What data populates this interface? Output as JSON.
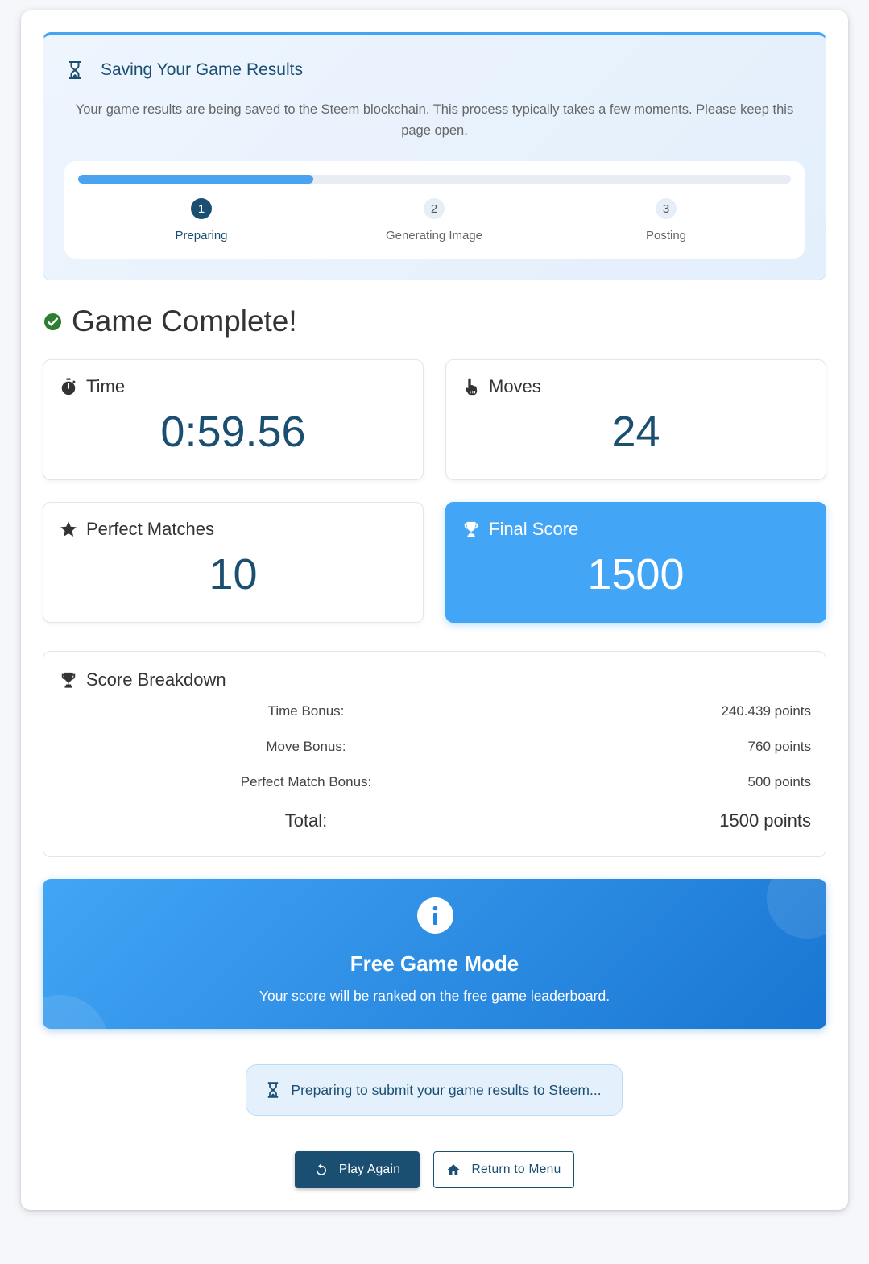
{
  "saving": {
    "icon": "hourglass-icon",
    "title": "Saving Your Game Results",
    "description": "Your game results are being saved to the Steem blockchain. This process typically takes a few moments. Please keep this page open.",
    "progress_fraction": 0.33,
    "steps": [
      {
        "number": "1",
        "label": "Preparing",
        "active": true
      },
      {
        "number": "2",
        "label": "Generating Image",
        "active": false
      },
      {
        "number": "3",
        "label": "Posting",
        "active": false
      }
    ]
  },
  "game_complete": {
    "icon": "check-circle-icon",
    "title": "Game Complete!"
  },
  "stats": {
    "time": {
      "icon": "stopwatch-icon",
      "label": "Time",
      "value": "0:59.56"
    },
    "moves": {
      "icon": "pointer-hand-icon",
      "label": "Moves",
      "value": "24"
    },
    "perfect": {
      "icon": "star-icon",
      "label": "Perfect Matches",
      "value": "10"
    },
    "final": {
      "icon": "trophy-icon",
      "label": "Final Score",
      "value": "1500"
    }
  },
  "breakdown": {
    "icon": "trophy-icon",
    "title": "Score Breakdown",
    "rows": [
      {
        "label": "Time Bonus:",
        "value": "240.439 points"
      },
      {
        "label": "Move Bonus:",
        "value": "760 points"
      },
      {
        "label": "Perfect Match Bonus:",
        "value": "500 points"
      }
    ],
    "total": {
      "label": "Total:",
      "value": "1500 points"
    }
  },
  "free_mode": {
    "icon": "info-icon",
    "title": "Free Game Mode",
    "description": "Your score will be ranked on the free game leaderboard."
  },
  "status": {
    "icon": "hourglass-icon",
    "text": "Preparing to submit your game results to Steem..."
  },
  "buttons": {
    "play_again": {
      "icon": "replay-icon",
      "label": "Play Again"
    },
    "return_menu": {
      "icon": "home-icon",
      "label": "Return to Menu"
    }
  },
  "colors": {
    "primary": "#1b4f72",
    "accent": "#42a5f5",
    "success": "#2e7d32"
  }
}
